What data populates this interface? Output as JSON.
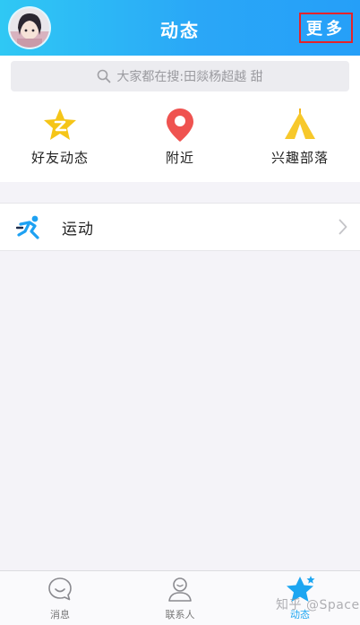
{
  "header": {
    "title": "动态",
    "more_label": "更多",
    "highlight_color": "#e5232a",
    "gradient": [
      "#2fc8f4",
      "#259ff8"
    ]
  },
  "search": {
    "placeholder": "大家都在搜:田燚杨超越 甜",
    "icon": "search-icon"
  },
  "quick_actions": [
    {
      "label": "好友动态",
      "icon": "friends-feed-star-icon",
      "color": "#f5c518"
    },
    {
      "label": "附近",
      "icon": "location-pin-icon",
      "color": "#ef5350"
    },
    {
      "label": "兴趣部落",
      "icon": "tribe-tent-icon",
      "color": "#f7c82b"
    }
  ],
  "list": [
    {
      "label": "运动",
      "icon": "running-man-icon",
      "color": "#1ea1f2"
    }
  ],
  "tabbar": {
    "tabs": [
      {
        "label": "消息",
        "icon": "chat-bubble-icon",
        "active": false
      },
      {
        "label": "联系人",
        "icon": "contacts-person-icon",
        "active": false
      },
      {
        "label": "动态",
        "icon": "star-icon",
        "active": true
      }
    ],
    "active_color": "#1da6f1"
  },
  "watermark": "知乎 @Space"
}
